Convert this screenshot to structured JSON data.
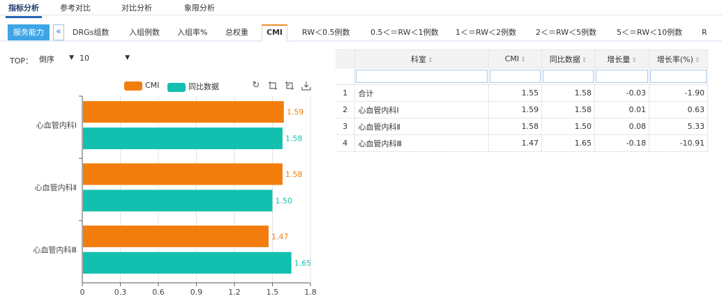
{
  "top_tabs": [
    {
      "label": "指标分析",
      "active": true
    },
    {
      "label": "参考对比",
      "active": false
    },
    {
      "label": "对比分析",
      "active": false
    },
    {
      "label": "象限分析",
      "active": false
    }
  ],
  "sub_tabs": {
    "group_label": "服务能力",
    "collapse_glyph": "«",
    "items": [
      {
        "label": "DRGs组数",
        "active": false
      },
      {
        "label": "入组例数",
        "active": false
      },
      {
        "label": "入组率%",
        "active": false
      },
      {
        "label": "总权重",
        "active": false
      },
      {
        "label": "CMI",
        "active": true
      },
      {
        "label": "RW＜0.5例数",
        "active": false
      },
      {
        "label": "0.5＜＝RW＜1例数",
        "active": false
      },
      {
        "label": "1＜＝RW＜2例数",
        "active": false
      },
      {
        "label": "2＜＝RW＜5例数",
        "active": false
      },
      {
        "label": "5＜＝RW＜10例数",
        "active": false
      },
      {
        "label": "R",
        "active": false
      }
    ]
  },
  "filter": {
    "top_label": "TOP：",
    "order_value": "倒序",
    "count_value": "10"
  },
  "toolbox": {
    "icons": [
      "refresh-icon",
      "zoom-icon",
      "zoom-reset-icon",
      "download-icon"
    ]
  },
  "chart_data": {
    "type": "bar",
    "orientation": "horizontal",
    "categories": [
      "心血管内科Ⅰ",
      "心血管内科Ⅱ",
      "心血管内科Ⅲ"
    ],
    "series": [
      {
        "name": "CMI",
        "color": "#f27d0c",
        "values": [
          1.59,
          1.58,
          1.47
        ]
      },
      {
        "name": "同比数据",
        "color": "#13bfae",
        "values": [
          1.58,
          1.5,
          1.65
        ]
      }
    ],
    "xlim": [
      0,
      1.8
    ],
    "xticks": [
      "0",
      "0.3",
      "0.6",
      "0.9",
      "1.2",
      "1.5",
      "1.8"
    ],
    "grid": true,
    "legend_position": "top"
  },
  "table": {
    "columns": [
      "科室",
      "CMI",
      "同比数据",
      "增长量",
      "增长率(%)"
    ],
    "rows": [
      {
        "idx": "1",
        "dept": "合计",
        "cmi": "1.55",
        "yoy": "1.58",
        "growth": "-0.03",
        "rate": "-1.90"
      },
      {
        "idx": "2",
        "dept": "心血管内科Ⅰ",
        "cmi": "1.59",
        "yoy": "1.58",
        "growth": "0.01",
        "rate": "0.63"
      },
      {
        "idx": "3",
        "dept": "心血管内科Ⅱ",
        "cmi": "1.58",
        "yoy": "1.50",
        "growth": "0.08",
        "rate": "5.33"
      },
      {
        "idx": "4",
        "dept": "心血管内科Ⅲ",
        "cmi": "1.47",
        "yoy": "1.65",
        "growth": "-0.18",
        "rate": "-10.91"
      }
    ]
  }
}
